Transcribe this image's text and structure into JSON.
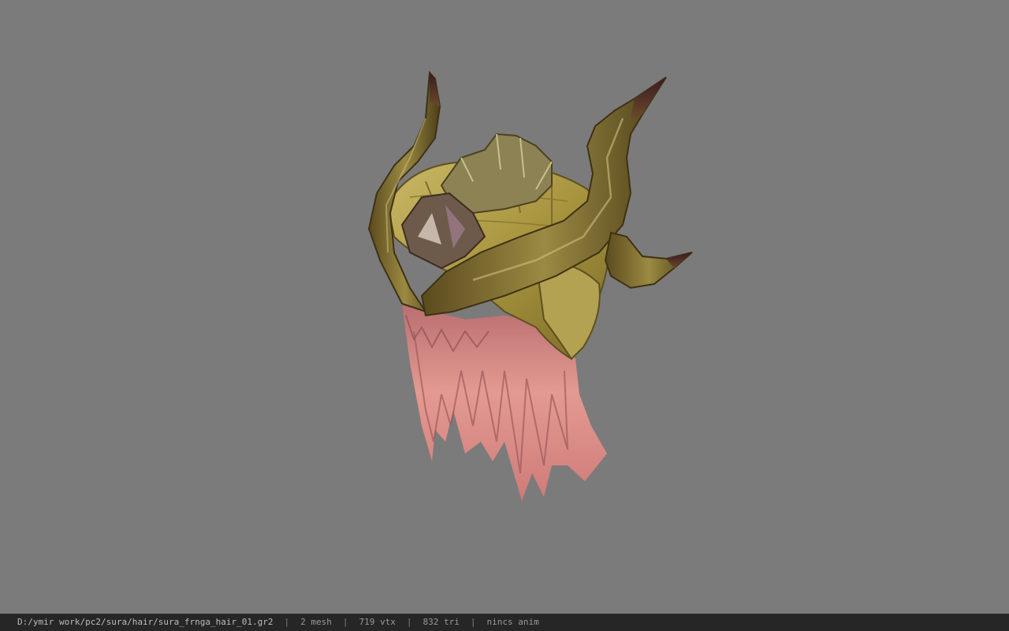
{
  "viewport": {
    "background_color": "#7b7b7b",
    "model_icon": "horned-helmet-hair-model"
  },
  "statusbar": {
    "file_path": "D:/ymir work/pc2/sura/hair/sura_frnga_hair_01.gr2",
    "separator": "|",
    "mesh_count": "2 mesh",
    "vertex_count": "719 vtx",
    "triangle_count": "832 tri",
    "anim_status": "nincs anim"
  },
  "colors": {
    "statusbar_bg": "#262626",
    "statusbar_text": "#9a9a9a",
    "hair": "#d98a84",
    "helmet": "#b8a54a",
    "horn": "#7a6a2a"
  }
}
